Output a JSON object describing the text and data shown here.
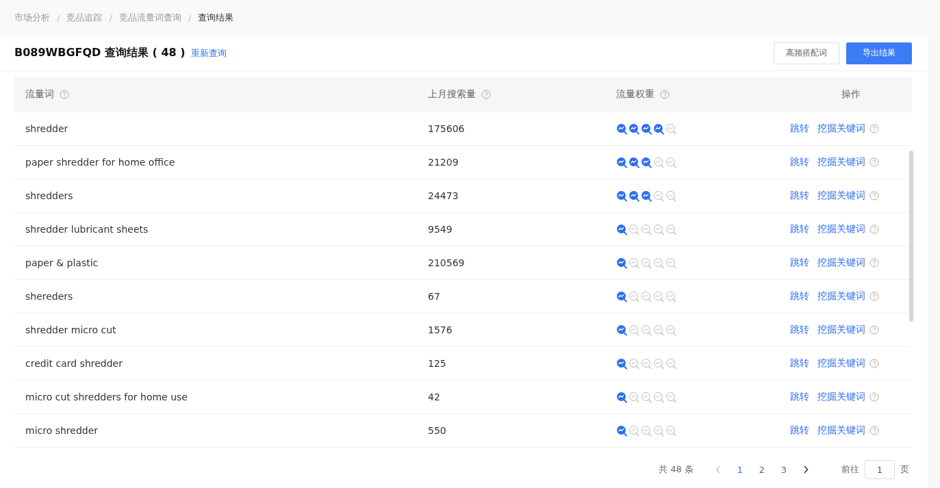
{
  "breadcrumb": [
    {
      "label": "市场分析",
      "current": false
    },
    {
      "label": "竞品追踪",
      "current": false
    },
    {
      "label": "竞品流量词查询",
      "current": false
    },
    {
      "label": "查询结果",
      "current": true
    }
  ],
  "breadcrumb_separator": "/",
  "header": {
    "title": "B089WBGFQD 查询结果 ( 48 )",
    "requery_link": "重新查询",
    "buttons": [
      {
        "label": "高频搭配词",
        "kind": "default"
      },
      {
        "label": "导出结果",
        "kind": "primary"
      }
    ]
  },
  "table": {
    "columns": [
      {
        "label": "流量词",
        "help": true
      },
      {
        "label": "上月搜索量",
        "help": true
      },
      {
        "label": "流量权重",
        "help": true
      },
      {
        "label": "操作",
        "help": false
      }
    ],
    "rows": [
      {
        "keyword": "shredder",
        "volume": "175606",
        "stars": 4,
        "action_1": "跳转",
        "action_2": "挖掘关键词"
      },
      {
        "keyword": "paper shredder for home office",
        "volume": "21209",
        "stars": 3,
        "action_1": "跳转",
        "action_2": "挖掘关键词"
      },
      {
        "keyword": "shredders",
        "volume": "24473",
        "stars": 3,
        "action_1": "跳转",
        "action_2": "挖掘关键词"
      },
      {
        "keyword": "shredder lubricant sheets",
        "volume": "9549",
        "stars": 1,
        "action_1": "跳转",
        "action_2": "挖掘关键词"
      },
      {
        "keyword": "paper & plastic",
        "volume": "210569",
        "stars": 1,
        "action_1": "跳转",
        "action_2": "挖掘关键词"
      },
      {
        "keyword": "shereders",
        "volume": "67",
        "stars": 1,
        "action_1": "跳转",
        "action_2": "挖掘关键词"
      },
      {
        "keyword": "shredder micro cut",
        "volume": "1576",
        "stars": 1,
        "action_1": "跳转",
        "action_2": "挖掘关键词"
      },
      {
        "keyword": "credit card shredder",
        "volume": "125",
        "stars": 1,
        "action_1": "跳转",
        "action_2": "挖掘关键词"
      },
      {
        "keyword": "micro cut shredders for home use",
        "volume": "42",
        "stars": 1,
        "action_1": "跳转",
        "action_2": "挖掘关键词"
      },
      {
        "keyword": "micro shredder",
        "volume": "550",
        "stars": 1,
        "action_1": "跳转",
        "action_2": "挖掘关键词"
      }
    ]
  },
  "pagination": {
    "total": "共 48 条",
    "pages": [
      {
        "label": "1",
        "selected": true
      },
      {
        "label": "2",
        "selected": false
      },
      {
        "label": "3",
        "selected": false
      }
    ],
    "goto_label": "前往",
    "goto_value": "1",
    "goto_suffix": "页"
  }
}
